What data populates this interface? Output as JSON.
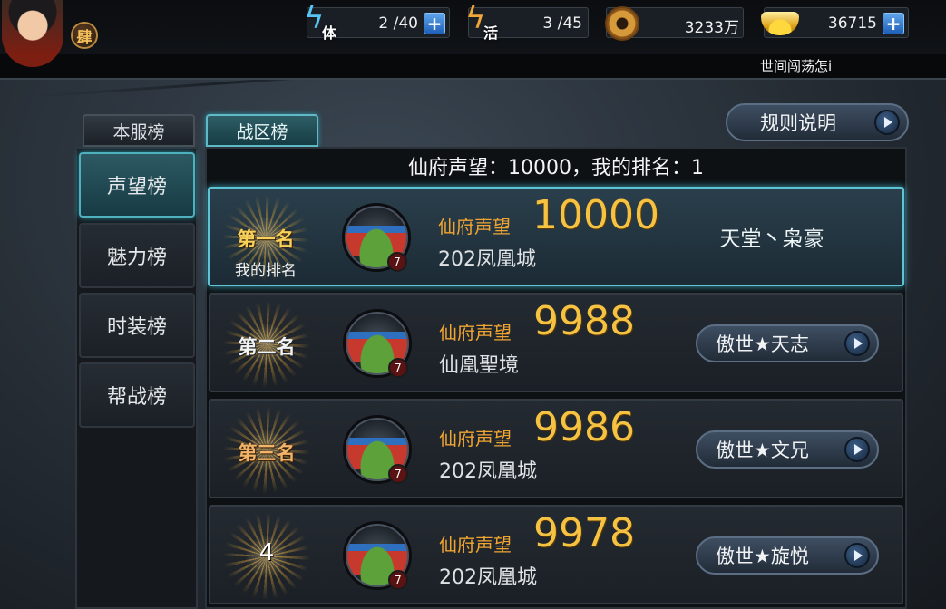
{
  "header": {
    "vip_badge": "肆",
    "stamina": {
      "label": "体",
      "value": "2 /40"
    },
    "vitality": {
      "label": "活",
      "value": "3 /45"
    },
    "copper": {
      "value": "3233万"
    },
    "gold": {
      "value": "36715"
    },
    "marquee": "世间闯荡怎i"
  },
  "tabs": [
    {
      "label": "本服榜",
      "active": false
    },
    {
      "label": "战区榜",
      "active": true
    }
  ],
  "rules_button": "规则说明",
  "sidebar": {
    "items": [
      {
        "label": "声望榜",
        "active": true
      },
      {
        "label": "魅力榜",
        "active": false
      },
      {
        "label": "时装榜",
        "active": false
      },
      {
        "label": "帮战榜",
        "active": false
      }
    ]
  },
  "summary": "仙府声望：10000，我的排名：1",
  "rows": [
    {
      "rank": "第一名",
      "mine_label": "我的排名",
      "level": "7",
      "rep_label": "仙府声望",
      "rep_value": "10000",
      "city": "202凤凰城",
      "player": "天堂丶枭豪"
    },
    {
      "rank": "第二名",
      "level": "7",
      "rep_label": "仙府声望",
      "rep_value": "9988",
      "city": "仙凰聖境",
      "player": "傲世★天志"
    },
    {
      "rank": "第三名",
      "level": "7",
      "rep_label": "仙府声望",
      "rep_value": "9986",
      "city": "202凤凰城",
      "player": "傲世★文兄"
    },
    {
      "rank": "4",
      "level": "7",
      "rep_label": "仙府声望",
      "rep_value": "9978",
      "city": "202凤凰城",
      "player": "傲世★旋悦"
    }
  ]
}
